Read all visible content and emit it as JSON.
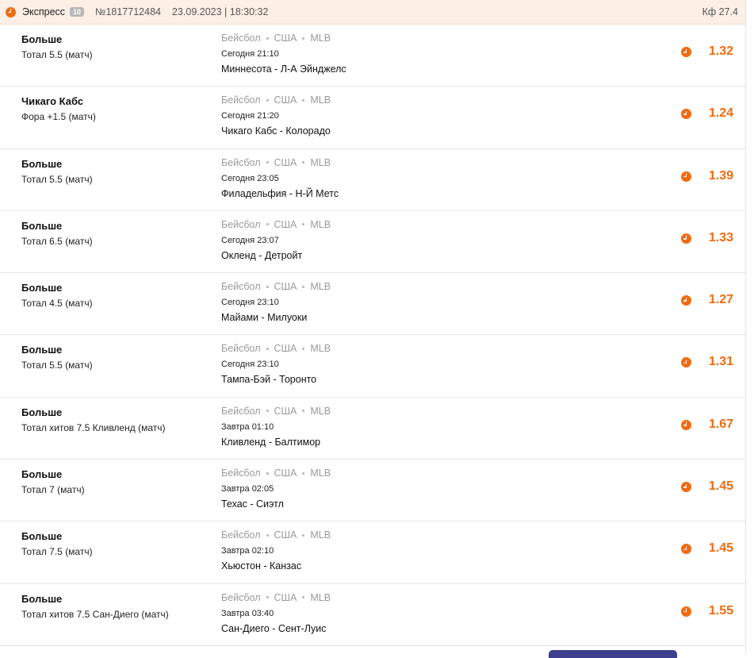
{
  "header": {
    "type": "Экспресс",
    "count": "10",
    "number": "№1817712484",
    "datetime": "23.09.2023 | 18:30:32",
    "coef": "Кф 27.4",
    "icon": "clock-icon",
    "accent": "#f26a10"
  },
  "bets": [
    {
      "selection": "Больше",
      "market": "Тотал 5.5 (матч)",
      "sport": "Бейсбол",
      "country": "США",
      "league": "MLB",
      "time": "Сегодня 21:10",
      "match": "Миннесота - Л-А Эйнджелс",
      "odds": "1.32"
    },
    {
      "selection": "Чикаго Кабс",
      "market": "Фора +1.5 (матч)",
      "sport": "Бейсбол",
      "country": "США",
      "league": "MLB",
      "time": "Сегодня 21:20",
      "match": "Чикаго Кабс - Колорадо",
      "odds": "1.24"
    },
    {
      "selection": "Больше",
      "market": "Тотал 5.5 (матч)",
      "sport": "Бейсбол",
      "country": "США",
      "league": "MLB",
      "time": "Сегодня 23:05",
      "match": "Филадельфия - Н-Й Метс",
      "odds": "1.39"
    },
    {
      "selection": "Больше",
      "market": "Тотал 6.5 (матч)",
      "sport": "Бейсбол",
      "country": "США",
      "league": "MLB",
      "time": "Сегодня 23:07",
      "match": "Окленд - Детройт",
      "odds": "1.33"
    },
    {
      "selection": "Больше",
      "market": "Тотал 4.5 (матч)",
      "sport": "Бейсбол",
      "country": "США",
      "league": "MLB",
      "time": "Сегодня 23:10",
      "match": "Майами - Милуоки",
      "odds": "1.27"
    },
    {
      "selection": "Больше",
      "market": "Тотал 5.5 (матч)",
      "sport": "Бейсбол",
      "country": "США",
      "league": "MLB",
      "time": "Сегодня 23:10",
      "match": "Тампа-Бэй - Торонто",
      "odds": "1.31"
    },
    {
      "selection": "Больше",
      "market": "Тотал хитов 7.5 Кливленд (матч)",
      "sport": "Бейсбол",
      "country": "США",
      "league": "MLB",
      "time": "Завтра 01:10",
      "match": "Кливленд - Балтимор",
      "odds": "1.67"
    },
    {
      "selection": "Больше",
      "market": "Тотал 7 (матч)",
      "sport": "Бейсбол",
      "country": "США",
      "league": "MLB",
      "time": "Завтра 02:05",
      "match": "Техас - Сиэтл",
      "odds": "1.45"
    },
    {
      "selection": "Больше",
      "market": "Тотал 7.5 (матч)",
      "sport": "Бейсбол",
      "country": "США",
      "league": "MLB",
      "time": "Завтра 02:10",
      "match": "Хьюстон - Канзас",
      "odds": "1.45"
    },
    {
      "selection": "Больше",
      "market": "Тотал хитов 7.5 Сан-Диего (матч)",
      "sport": "Бейсбол",
      "country": "США",
      "league": "MLB",
      "time": "Завтра 03:40",
      "match": "Сан-Диего - Сент-Луис",
      "odds": "1.55"
    }
  ]
}
